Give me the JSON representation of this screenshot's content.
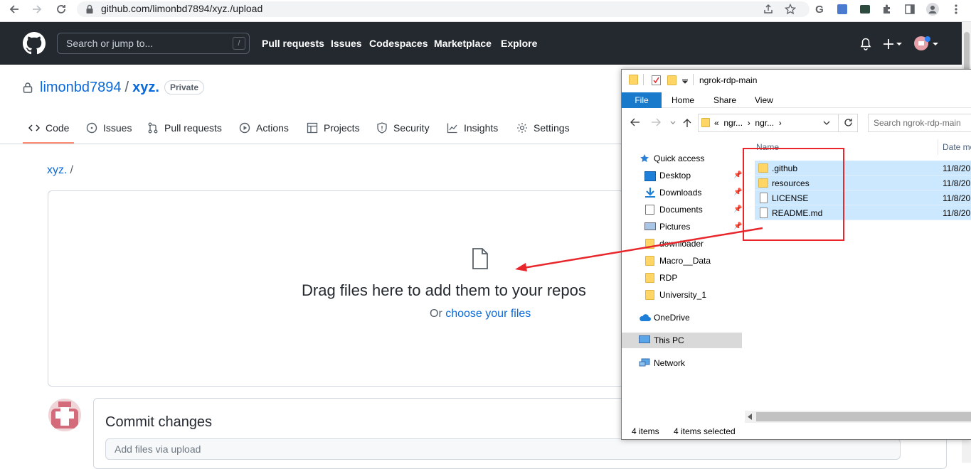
{
  "browser": {
    "url": "github.com/limonbd7894/xyz./upload"
  },
  "github_header": {
    "search_placeholder": "Search or jump to...",
    "search_key": "/",
    "nav": [
      "Pull requests",
      "Issues",
      "Codespaces",
      "Marketplace",
      "Explore"
    ]
  },
  "repo": {
    "owner": "limonbd7894",
    "separator": "/",
    "name": "xyz.",
    "visibility": "Private"
  },
  "tabs": [
    {
      "label": "Code",
      "icon": "code-icon"
    },
    {
      "label": "Issues",
      "icon": "issue-icon"
    },
    {
      "label": "Pull requests",
      "icon": "pull-request-icon"
    },
    {
      "label": "Actions",
      "icon": "play-icon"
    },
    {
      "label": "Projects",
      "icon": "table-icon"
    },
    {
      "label": "Security",
      "icon": "shield-icon"
    },
    {
      "label": "Insights",
      "icon": "graph-icon"
    },
    {
      "label": "Settings",
      "icon": "gear-icon"
    }
  ],
  "breadcrumb": {
    "repo": "xyz.",
    "separator": "/"
  },
  "upload": {
    "drag_text": "Drag files here to add them to your repos",
    "or_text": "Or",
    "choose_link": "choose your files"
  },
  "commit": {
    "title": "Commit changes",
    "input_placeholder": "Add files via upload"
  },
  "explorer": {
    "title": "ngrok-rdp-main",
    "ribbon": {
      "file": "File",
      "home": "Home",
      "share": "Share",
      "view": "View"
    },
    "address": {
      "prefix": "«",
      "part1": "ngr...",
      "sep": "›",
      "part2": "ngr...",
      "sep2": "›"
    },
    "search_placeholder": "Search ngrok-rdp-main",
    "nav": {
      "quick_access": "Quick access",
      "items": [
        "Desktop",
        "Downloads",
        "Documents",
        "Pictures",
        "downloader",
        "Macro__Data",
        "RDP",
        "University_1"
      ],
      "onedrive": "OneDrive",
      "this_pc": "This PC",
      "network": "Network"
    },
    "columns": {
      "name": "Name",
      "date": "Date mo"
    },
    "files": [
      {
        "name": ".github",
        "date": "11/8/20",
        "kind": "folder"
      },
      {
        "name": "resources",
        "date": "11/8/20",
        "kind": "folder"
      },
      {
        "name": "LICENSE",
        "date": "11/8/20",
        "kind": "file"
      },
      {
        "name": "README.md",
        "date": "11/8/20",
        "kind": "file"
      }
    ],
    "status": {
      "items": "4 items",
      "selected": "4 items selected"
    }
  },
  "colors": {
    "gh_header": "#24292f",
    "link": "#0969da",
    "tab_underline": "#fd8c73",
    "explorer_selection": "#cce8ff",
    "file_tab": "#1979ca",
    "annotation_red": "#e8262b"
  }
}
